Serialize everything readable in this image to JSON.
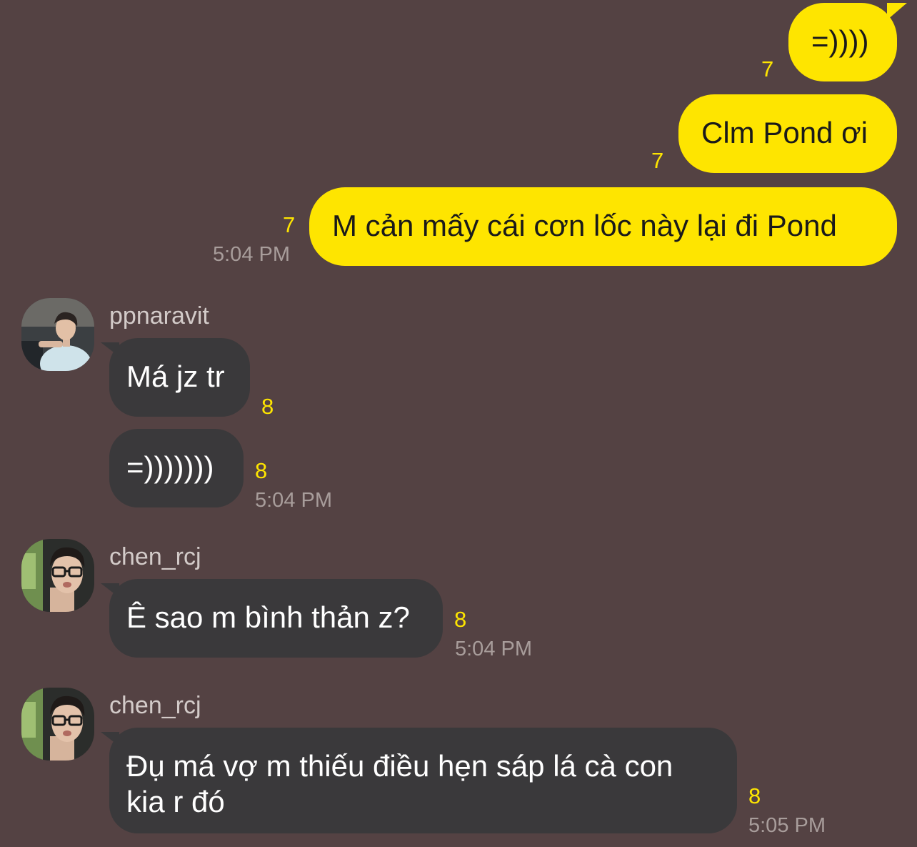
{
  "colors": {
    "background": "#544243",
    "my_bubble": "#fee500",
    "their_bubble": "#3a393b",
    "unread_count": "#fee500",
    "timestamp": "#a89d9b",
    "sender_name": "#d3cbc9"
  },
  "outgoing": [
    {
      "text": "=))))",
      "unread": "7"
    },
    {
      "text": "Clm Pond ơi",
      "unread": "7"
    },
    {
      "text": "M cản mấy cái cơn lốc này lại đi Pond",
      "unread": "7",
      "time": "5:04 PM"
    }
  ],
  "groups": [
    {
      "sender": "ppnaravit",
      "avatar_icon": "profile-photo-ppnaravit",
      "messages": [
        {
          "text": "Má jz tr",
          "unread": "8"
        },
        {
          "text": "=)))))))",
          "unread": "8",
          "time": "5:04 PM"
        }
      ]
    },
    {
      "sender": "chen_rcj",
      "avatar_icon": "profile-photo-chen-rcj",
      "messages": [
        {
          "text": "Ê sao m bình thản z?",
          "unread": "8",
          "time": "5:04 PM"
        }
      ]
    },
    {
      "sender": "chen_rcj",
      "avatar_icon": "profile-photo-chen-rcj",
      "messages": [
        {
          "text_line1": "Đụ má vợ m thiếu điều hẹn sáp lá cà con",
          "text_line2": "kia r đó",
          "unread": "8",
          "time": "5:05 PM"
        }
      ]
    }
  ]
}
